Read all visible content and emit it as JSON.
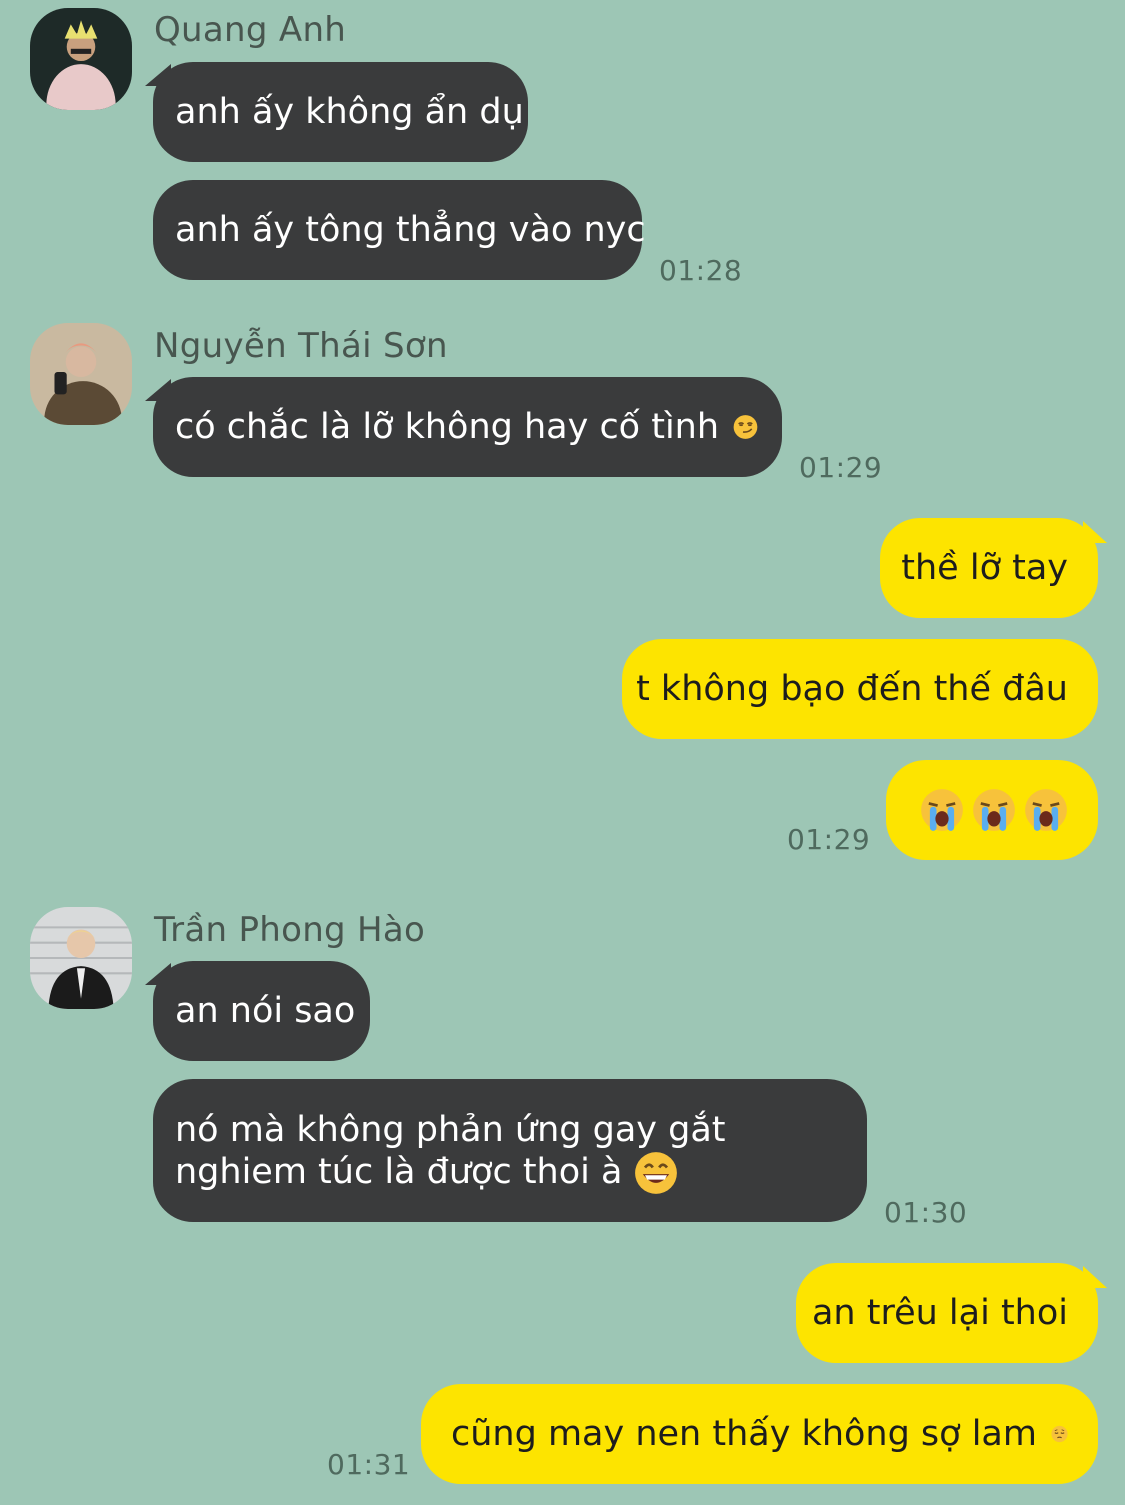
{
  "messages": [
    {
      "sender": "Quang Anh",
      "avatar": "avatar-quang-anh",
      "texts": [
        "anh ấy không ẩn dụ",
        "anh ấy tông thẳng vào nyc"
      ],
      "time": "01:28"
    },
    {
      "sender": "Nguyễn Thái Sơn",
      "avatar": "avatar-nguyen-thai-son",
      "texts": [
        "có chắc là lỡ không hay cố tình"
      ],
      "emoji": "smirk-emoji",
      "time": "01:29"
    },
    {
      "sender": "me",
      "texts": [
        "thề lỡ tay",
        "t không bạo đến thế đâu"
      ],
      "emojis": [
        "loudly-crying-emoji",
        "loudly-crying-emoji",
        "loudly-crying-emoji"
      ],
      "time": "01:29"
    },
    {
      "sender": "Trần Phong Hào",
      "avatar": "avatar-tran-phong-hao",
      "texts": [
        "an nói sao",
        "nó mà không phản ứng gay gắt nghiem túc là được thoi à"
      ],
      "emoji": "grinning-emoji",
      "time": "01:30"
    },
    {
      "sender": "me",
      "texts": [
        "an trêu lại thoi",
        "cũng may nen thấy không sợ lam"
      ],
      "emoji": "pensive-emoji",
      "time": "01:31"
    }
  ],
  "colors": {
    "background": "#9dc6b5",
    "incoming_bubble": "#3a3b3c",
    "outgoing_bubble": "#fde400"
  }
}
